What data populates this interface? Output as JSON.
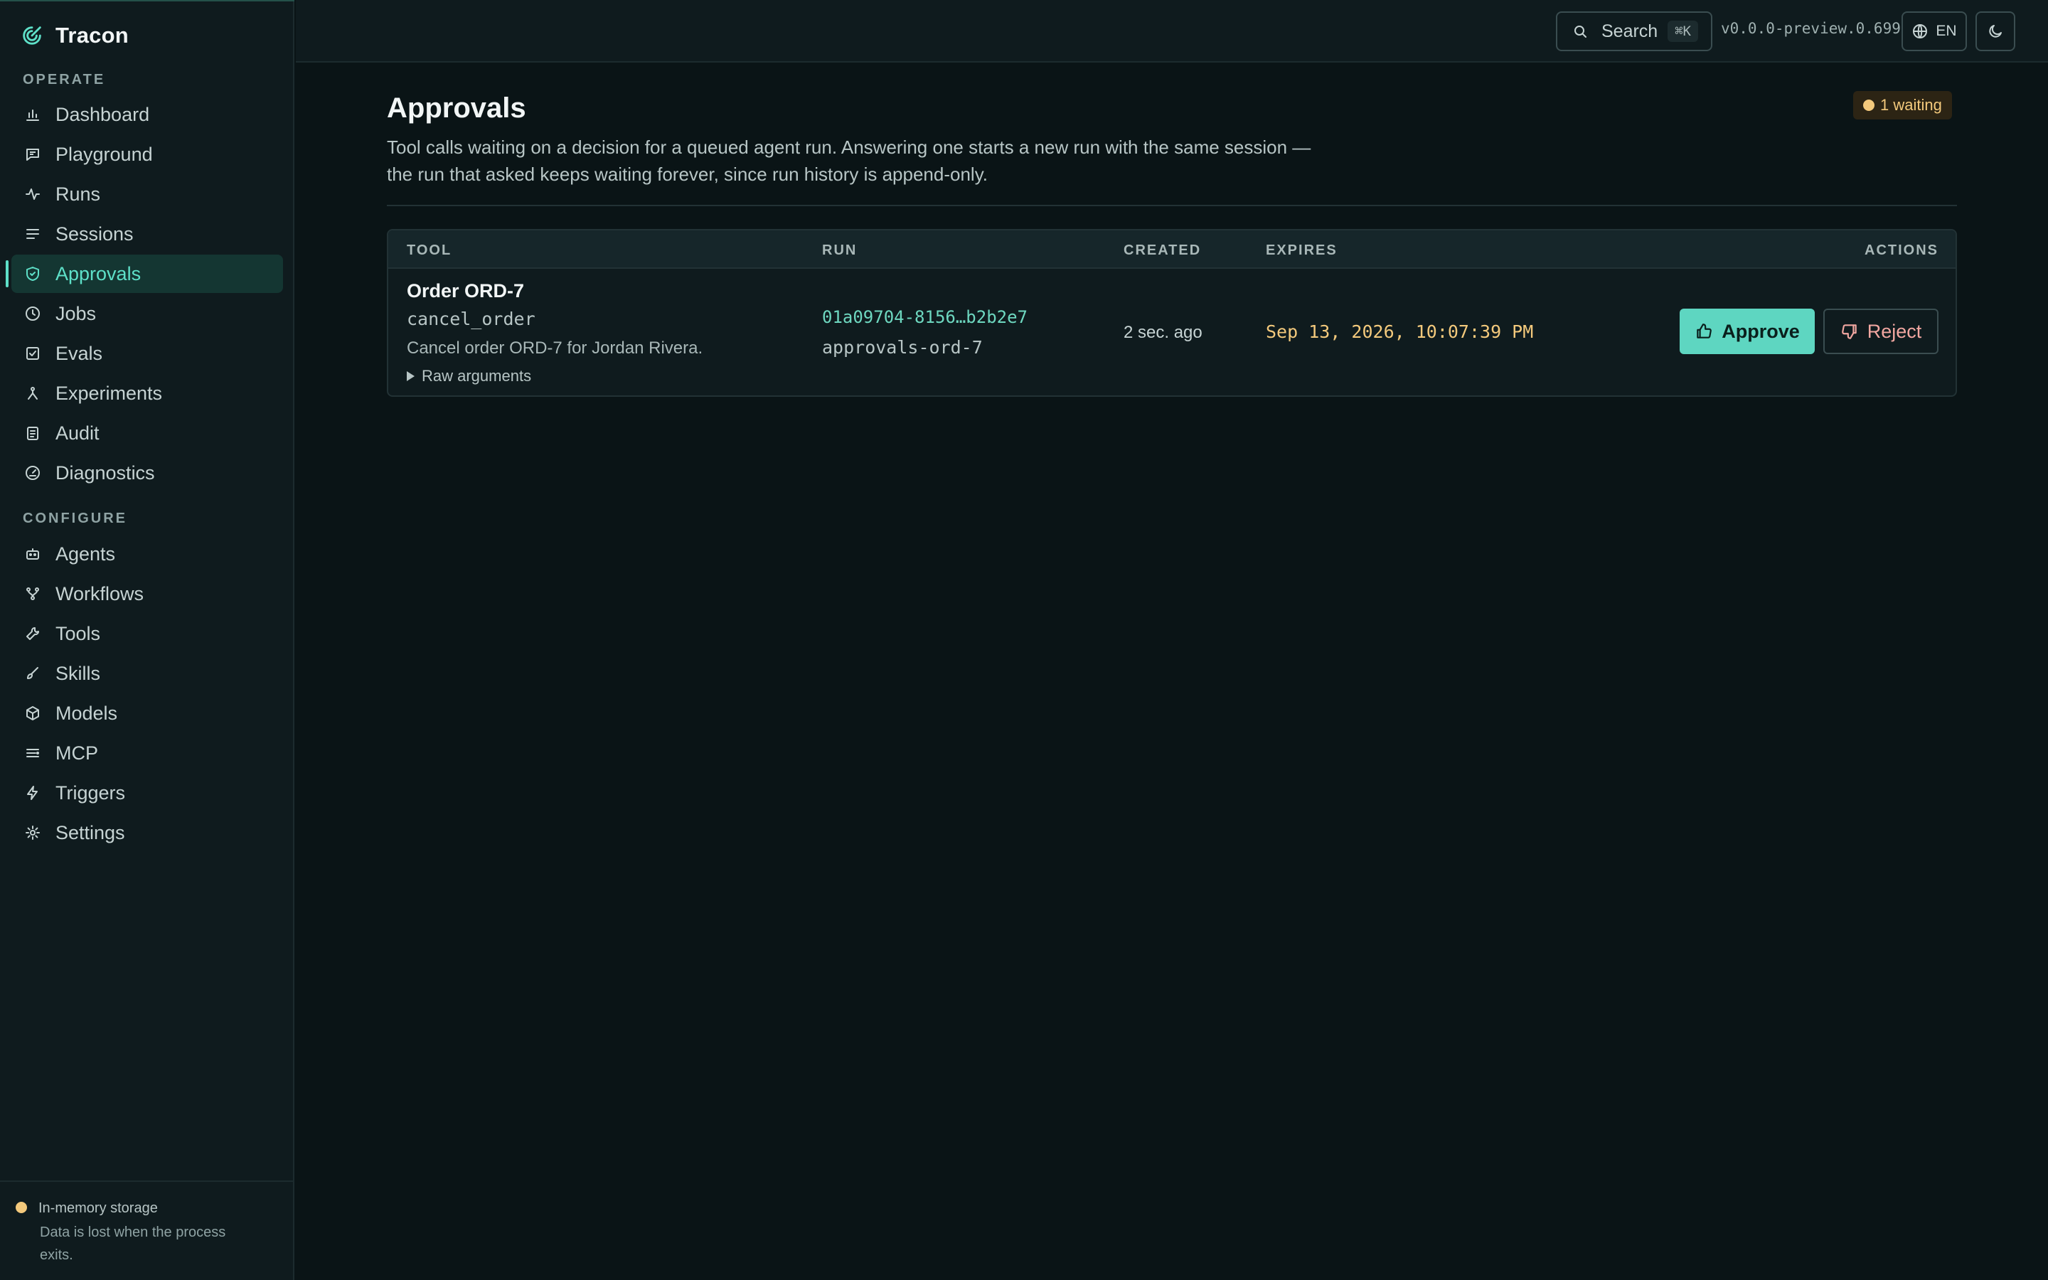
{
  "app": {
    "name": "Tracon"
  },
  "sidebar": {
    "sections": [
      {
        "title": "OPERATE",
        "items": [
          {
            "label": "Dashboard",
            "icon": "bar-chart-icon"
          },
          {
            "label": "Playground",
            "icon": "chat-icon"
          },
          {
            "label": "Runs",
            "icon": "activity-icon"
          },
          {
            "label": "Sessions",
            "icon": "list-icon"
          },
          {
            "label": "Approvals",
            "icon": "shield-check-icon",
            "active": true
          },
          {
            "label": "Jobs",
            "icon": "clock-icon"
          },
          {
            "label": "Evals",
            "icon": "check-square-icon"
          },
          {
            "label": "Experiments",
            "icon": "branch-icon"
          },
          {
            "label": "Audit",
            "icon": "clipboard-icon"
          },
          {
            "label": "Diagnostics",
            "icon": "gauge-icon"
          }
        ]
      },
      {
        "title": "CONFIGURE",
        "items": [
          {
            "label": "Agents",
            "icon": "bot-icon"
          },
          {
            "label": "Workflows",
            "icon": "workflow-icon"
          },
          {
            "label": "Tools",
            "icon": "wrench-icon"
          },
          {
            "label": "Skills",
            "icon": "brush-icon"
          },
          {
            "label": "Models",
            "icon": "cube-icon"
          },
          {
            "label": "MCP",
            "icon": "server-list-icon"
          },
          {
            "label": "Triggers",
            "icon": "lightning-icon"
          },
          {
            "label": "Settings",
            "icon": "gear-icon"
          }
        ]
      }
    ],
    "storage": {
      "title": "In-memory storage",
      "description": "Data is lost when the process exits."
    }
  },
  "topbar": {
    "search_label": "Search",
    "search_shortcut": "⌘K",
    "version": "v0.0.0-preview.0.699",
    "language": "EN"
  },
  "page": {
    "title": "Approvals",
    "description": "Tool calls waiting on a decision for a queued agent run. Answering one starts a new run with the same session — the run that asked keeps waiting forever, since run history is append-only.",
    "waiting_badge": "1 waiting"
  },
  "table": {
    "columns": {
      "tool": "TOOL",
      "run": "RUN",
      "created": "CREATED",
      "expires": "EXPIRES",
      "actions": "ACTIONS"
    },
    "rows": [
      {
        "title": "Order ORD-7",
        "tool_name": "cancel_order",
        "description": "Cancel order ORD-7 for Jordan Rivera.",
        "raw_args_label": "Raw arguments",
        "run_id": "01a09704-8156…b2b2e7",
        "session": "approvals-ord-7",
        "created": "2 sec. ago",
        "expires": "Sep 13, 2026, 10:07:39 PM",
        "approve_label": "Approve",
        "reject_label": "Reject"
      }
    ]
  },
  "colors": {
    "accent": "#5ed6c1",
    "warning": "#f3c97c",
    "danger": "#f2a7a1",
    "background": "#0a1416"
  }
}
